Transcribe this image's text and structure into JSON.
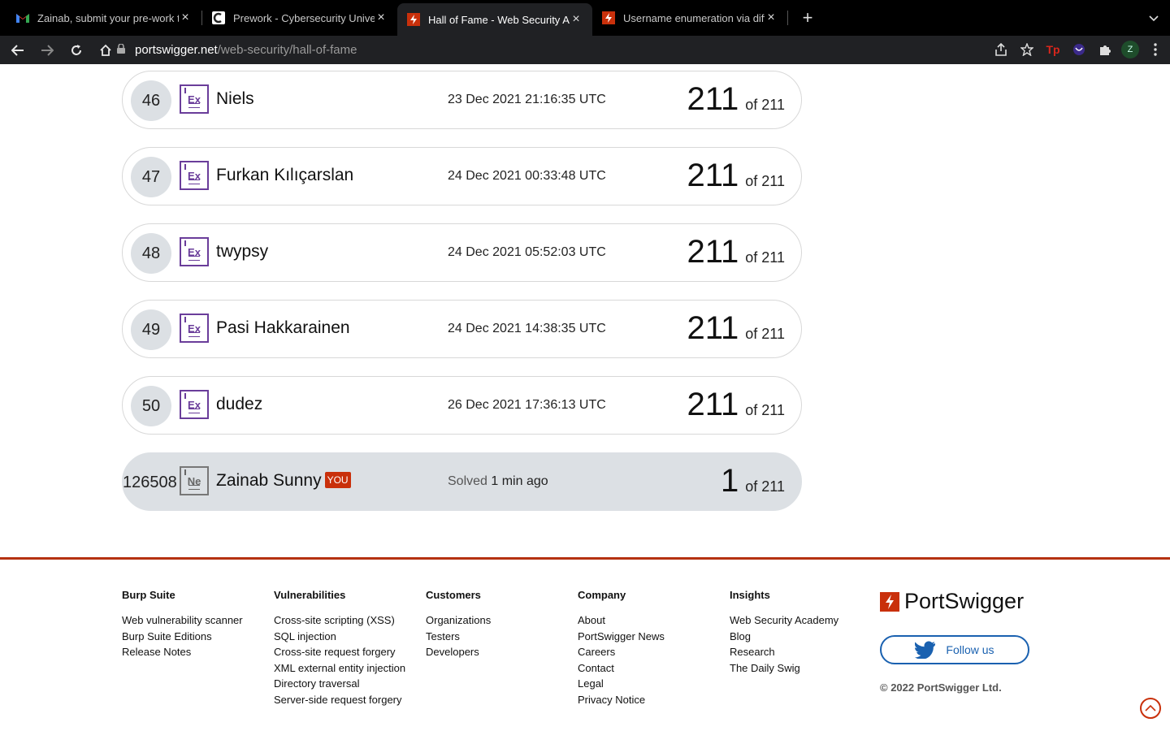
{
  "browser": {
    "tabs": [
      {
        "title": "Zainab, submit your pre-work t",
        "favicon": "gmail-icon",
        "active": false
      },
      {
        "title": "Prework - Cybersecurity Unive",
        "favicon": "codepath-icon",
        "active": false
      },
      {
        "title": "Hall of Fame - Web Security Ac",
        "favicon": "portswigger-icon",
        "active": true
      },
      {
        "title": "Username enumeration via diffe",
        "favicon": "portswigger-icon",
        "active": false
      }
    ],
    "url_host": "portswigger.net",
    "url_path": "/web-security/hall-of-fame",
    "profile_initial": "Z",
    "colors": {
      "frame": "#000000",
      "toolbar": "#202124"
    }
  },
  "leaderboard": {
    "rows": [
      {
        "rank": "46",
        "badge": "Ex",
        "name": "Niels",
        "date": "23 Dec 2021 21:16:35 UTC",
        "score": "211",
        "of": "of 211"
      },
      {
        "rank": "47",
        "badge": "Ex",
        "name": "Furkan Kılıçarslan",
        "date": "24 Dec 2021 00:33:48 UTC",
        "score": "211",
        "of": "of 211"
      },
      {
        "rank": "48",
        "badge": "Ex",
        "name": "twypsy",
        "date": "24 Dec 2021 05:52:03 UTC",
        "score": "211",
        "of": "of 211"
      },
      {
        "rank": "49",
        "badge": "Ex",
        "name": "Pasi Hakkarainen",
        "date": "24 Dec 2021 14:38:35 UTC",
        "score": "211",
        "of": "of 211"
      },
      {
        "rank": "50",
        "badge": "Ex",
        "name": "dudez",
        "date": "26 Dec 2021 17:36:13 UTC",
        "score": "211",
        "of": "of 211"
      }
    ],
    "you": {
      "rank": "126508",
      "badge": "Ne",
      "name": "Zainab Sunny",
      "tag": "YOU",
      "solved_label": "Solved",
      "solved_time": "1 min ago",
      "score": "1",
      "of": "of 211"
    },
    "colors": {
      "expert_badge": "#6a3d9a",
      "you_row": "#dce0e4",
      "you_tag": "#c9300b"
    }
  },
  "footer": {
    "columns": [
      {
        "heading": "Burp Suite",
        "links": [
          "Web vulnerability scanner",
          "Burp Suite Editions",
          "Release Notes"
        ]
      },
      {
        "heading": "Vulnerabilities",
        "links": [
          "Cross-site scripting (XSS)",
          "SQL injection",
          "Cross-site request forgery",
          "XML external entity injection",
          "Directory traversal",
          "Server-side request forgery"
        ]
      },
      {
        "heading": "Customers",
        "links": [
          "Organizations",
          "Testers",
          "Developers"
        ]
      },
      {
        "heading": "Company",
        "links": [
          "About",
          "PortSwigger News",
          "Careers",
          "Contact",
          "Legal",
          "Privacy Notice"
        ]
      },
      {
        "heading": "Insights",
        "links": [
          "Web Security Academy",
          "Blog",
          "Research",
          "The Daily Swig"
        ]
      }
    ],
    "brand": "PortSwigger",
    "follow_label": "Follow us",
    "copyright": "© 2022 PortSwigger Ltd.",
    "colors": {
      "accent": "#c9300b",
      "twitter": "#1a61b0"
    }
  }
}
